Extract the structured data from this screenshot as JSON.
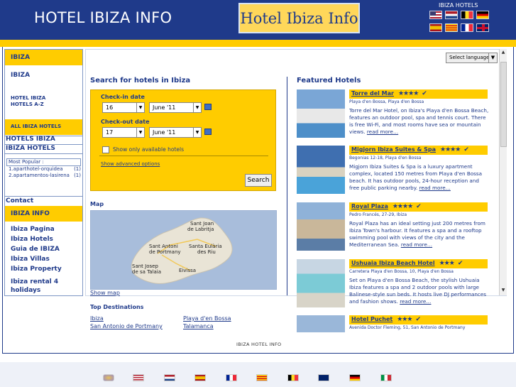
{
  "header": {
    "title": "HOTEL IBIZA INFO",
    "logo_text": "Hotel Ibiza Info",
    "hotels_label": "IBIZA HOTELS",
    "flags_row1": [
      "usa",
      "netherlands",
      "belgium",
      "germany"
    ],
    "flags_row2": [
      "spain",
      "catalonia",
      "france",
      "uk"
    ]
  },
  "sidebar": {
    "section1": "IBIZA",
    "ibiza_link": "IBIZA",
    "hotel_ibiza": "HOTEL IBIZA",
    "hotels_az": "HOTELS A-Z",
    "section2": "ALL IBIZA HOTELS",
    "hotels_ibiza": "HOTELS IBIZA",
    "ibiza_hotels": "IBIZA HOTELS",
    "most_popular": "Most Popular :",
    "popular": [
      {
        "name": "1.aparthotel-orquidea",
        "count": "(1)"
      },
      {
        "name": "2.apartamentos-lasirena",
        "count": "(1)"
      }
    ],
    "contact": "Contact",
    "section3": "IBIZA INFO",
    "info_links": [
      "Ibiza Pagina",
      "Ibiza Hotels",
      "Guia de IBIZA",
      "Ibiza Villas",
      "Ibiza Property",
      "Ibiza rental 4 holidays"
    ]
  },
  "language": {
    "label": "Select language"
  },
  "search": {
    "heading": "Search for hotels in Ibiza",
    "checkin_label": "Check-in date",
    "checkin_day": "16",
    "checkin_month": "June '11",
    "checkout_label": "Check-out date",
    "checkout_day": "17",
    "checkout_month": "June '11",
    "available_label": "Show only available hotels",
    "advanced": "Show advanced options",
    "button": "Search"
  },
  "map": {
    "heading": "Map",
    "labels": {
      "sant_joan_1": "Sant Joan",
      "sant_joan_2": "de Labritja",
      "sant_antoni_1": "Sant Antoni",
      "sant_antoni_2": "de Portmany",
      "santa_eularia_1": "Santa Eulària",
      "santa_eularia_2": "des Riu",
      "sant_josep_1": "Sant Josep",
      "sant_josep_2": "de sa Talaia",
      "eivissa": "Eivissa"
    },
    "show_map": "Show map"
  },
  "destinations": {
    "heading": "Top Destinations",
    "col1": [
      "Ibiza",
      "San Antonio de Portmany"
    ],
    "col2": [
      "Playa d'en Bossa",
      "Talamanca"
    ]
  },
  "featured": {
    "heading": "Featured Hotels",
    "hotels": [
      {
        "name": "Torre del Mar",
        "stars": "★★★★",
        "stars_count": 4,
        "address": "Playa d'en Bossa, Playa d'en Bossa",
        "desc": "Torre del Mar Hotel, on Ibiza's Playa d'en Bossa Beach, features an outdoor pool, spa and tennis court. There is free Wi-Fi, and most rooms have sea or mountain views.",
        "more": "read more…"
      },
      {
        "name": "Migjorn Ibiza Suites & Spa",
        "stars": "★★★★",
        "stars_count": 4,
        "address": "Begonias 12-18, Playa d'en Bossa",
        "desc": "Migjorn Ibiza Suites & Spa is a luxury apartment complex, located 150 metres from Playa d'en Bossa beach. It has outdoor pools, 24-hour reception and free public parking nearby.",
        "more": "read more…"
      },
      {
        "name": "Royal Plaza",
        "stars": "★★★★",
        "stars_count": 4,
        "address": "Pedro Francés, 27-29, Ibiza",
        "desc": "Royal Plaza has an ideal setting just 200 metres from Ibiza Town's harbour. It features a spa and a rooftop swimming pool with views of the city and the Mediterranean Sea.",
        "more": "read more…"
      },
      {
        "name": "Ushuaia Ibiza Beach Hotel",
        "stars": "★★★",
        "stars_count": 3,
        "address": "Carretera Playa d'en Bossa, 10, Playa d'en Bossa",
        "desc": "Set on Playa d'en Bossa Beach, the stylish Ushuaia Ibiza features a spa and 2 outdoor pools with large Balinese-style sun beds. It hosts live DJ performances and fashion shows.",
        "more": "read more…"
      },
      {
        "name": "Hotel Puchet",
        "stars": "★★★",
        "stars_count": 3,
        "address": "Avenida Doctor Fleming, 51, San Antonio de Portmany",
        "desc": "",
        "more": ""
      }
    ]
  },
  "footer": {
    "text": "IBIZA HOTEL INFO",
    "flags": [
      "ibiza",
      "usa",
      "netherlands",
      "spain",
      "france",
      "catalonia",
      "belgium",
      "uk",
      "germany",
      "italy"
    ]
  },
  "colors": {
    "navy": "#1f3a8a",
    "yellow": "#ffcc00"
  }
}
